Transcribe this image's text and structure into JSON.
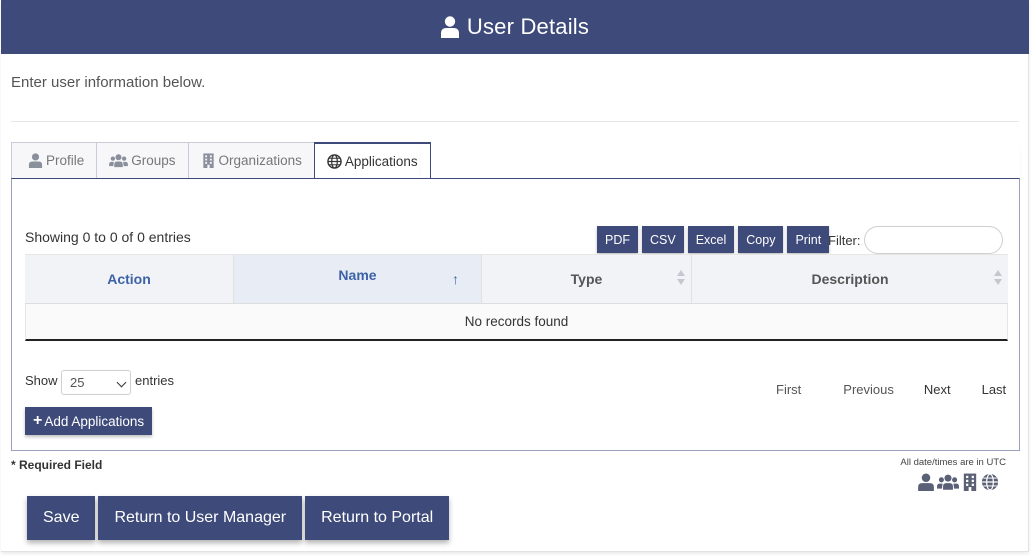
{
  "header": {
    "title": "User Details",
    "icon": "user-icon",
    "color": "#3d4a7a"
  },
  "intro": {
    "text": "Enter user information below."
  },
  "tabs": [
    {
      "label": "Profile",
      "icon": "user-icon",
      "active": false
    },
    {
      "label": "Groups",
      "icon": "users-icon",
      "active": false
    },
    {
      "label": "Organizations",
      "icon": "building-icon",
      "active": false
    },
    {
      "label": "Applications",
      "icon": "globe-icon",
      "active": true
    }
  ],
  "table_info": {
    "showing": "Showing 0 to 0 of 0 entries"
  },
  "export_buttons": [
    "PDF",
    "CSV",
    "Excel",
    "Copy",
    "Print"
  ],
  "filter": {
    "label": "Filter:",
    "value": ""
  },
  "table": {
    "columns": [
      "Action",
      "Name",
      "Type",
      "Description"
    ],
    "sort": {
      "column": "Name",
      "direction": "asc"
    },
    "empty_message": "No records found"
  },
  "length": {
    "show_label": "Show",
    "selected": "25",
    "entries_label": "entries"
  },
  "pagination": {
    "first": "First",
    "previous": "Previous",
    "next": "Next",
    "last": "Last"
  },
  "add_button": {
    "label": "Add Applications"
  },
  "required_note": "* Required Field",
  "utc_note": "All date/times are in UTC",
  "legend_icons": [
    "user-icon",
    "users-icon",
    "building-icon",
    "globe-icon"
  ],
  "footer": {
    "save": "Save",
    "return_manager": "Return to User Manager",
    "return_portal": "Return to Portal"
  },
  "colors": {
    "accent": "#3d4a7a",
    "link": "#3d62a8"
  }
}
